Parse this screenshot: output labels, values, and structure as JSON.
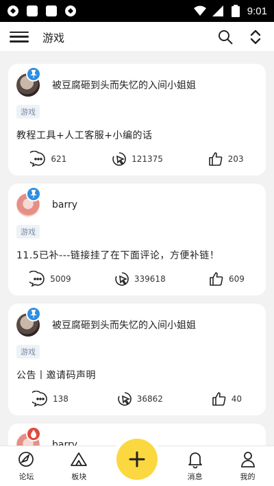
{
  "status_bar": {
    "time": "9:01"
  },
  "header": {
    "title": "游戏"
  },
  "posts": [
    {
      "author": "被豆腐砸到头而失忆的入间小姐姐",
      "tag": "游戏",
      "text": "教程工具+人工客服+小编的话",
      "comments": "621",
      "views": "121375",
      "likes": "203"
    },
    {
      "author": "barry",
      "tag": "游戏",
      "text": "11.5已补---链接挂了在下面评论，方便补链！",
      "comments": "5009",
      "views": "339618",
      "likes": "609"
    },
    {
      "author": "被豆腐砸到头而失忆的入间小姐姐",
      "tag": "游戏",
      "text": "公告丨邀请码声明",
      "comments": "138",
      "views": "36862",
      "likes": "40"
    },
    {
      "author": "barry"
    }
  ],
  "bottom_nav": {
    "forum": "论坛",
    "boards": "板块",
    "messages": "消息",
    "me": "我的"
  },
  "colors": {
    "accent": "#fcd840",
    "pin": "#2d8ee0",
    "tag_bg": "#eef2f7"
  }
}
